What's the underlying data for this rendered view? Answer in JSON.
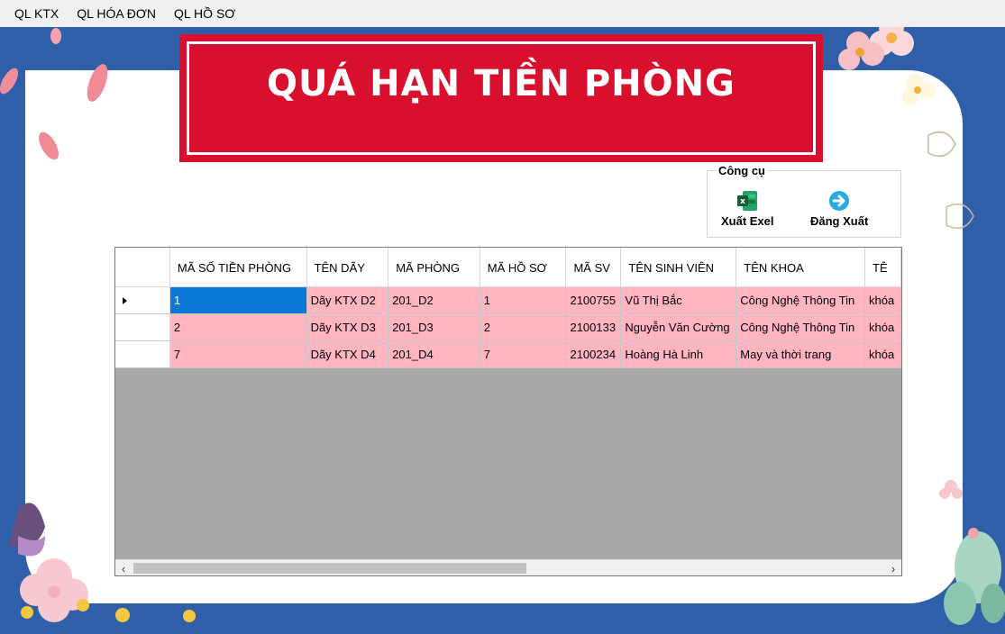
{
  "menu": [
    "QL KTX",
    "QL HÓA ĐƠN",
    "QL HỒ SƠ"
  ],
  "banner": {
    "title": "QUÁ HẠN TIỀN PHÒNG"
  },
  "tools": {
    "group_label": "Công cụ",
    "excel_label": "Xuất Exel",
    "logout_label": "Đăng Xuất"
  },
  "grid": {
    "headers": [
      "MÃ SỐ TIỀN PHÒNG",
      "TÊN DÃY",
      "MÃ PHÒNG",
      "MÃ HỒ SƠ",
      "MÃ SV",
      "TÊN SINH VIÊN",
      "TÊN KHOA",
      "TÊ"
    ],
    "rows": [
      [
        "1",
        "Dãy KTX D2",
        "201_D2",
        "1",
        "2100755",
        "Vũ Thị Bắc",
        "Công Nghệ Thông Tin",
        "khóa"
      ],
      [
        "2",
        "Dãy KTX D3",
        "201_D3",
        "2",
        "2100133",
        "Nguyễn Văn Cường",
        "Công Nghệ Thông Tin",
        "khóa"
      ],
      [
        "7",
        "Dãy KTX D4",
        "201_D4",
        "7",
        "2100234",
        "Hoàng Hà Linh",
        "May và thời trang",
        "khóa"
      ]
    ]
  },
  "colors": {
    "banner": "#d8102e",
    "row": "#ffb6c1",
    "selected": "#0a78d4",
    "background": "#2f5fa8"
  }
}
